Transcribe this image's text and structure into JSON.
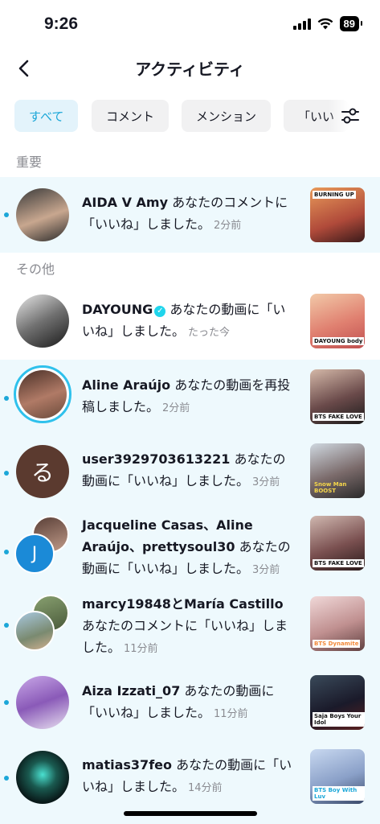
{
  "status": {
    "time": "9:26",
    "battery": "89"
  },
  "header": {
    "title": "アクティビティ"
  },
  "filters": [
    {
      "label": "すべて",
      "active": true
    },
    {
      "label": "コメント",
      "active": false
    },
    {
      "label": "メンション",
      "active": false
    },
    {
      "label": "「いい",
      "active": false
    }
  ],
  "sections": {
    "important": "重要",
    "other": "その他"
  },
  "notifications": [
    {
      "user": "AIDA V Amy",
      "message": "あなたのコメントに「いいね」しました。",
      "time": "2分前",
      "unread": true,
      "thumb_text": "BURNING UP"
    },
    {
      "user": "DAYOUNG",
      "verified": true,
      "message": "あなたの動画に「いいね」しました。",
      "time": "たった今",
      "unread": false,
      "thumb_text": "DAYOUNG body"
    },
    {
      "user": "Aline Araújo",
      "message": "あなたの動画を再投稿しました。",
      "time": "2分前",
      "unread": true,
      "thumb_text": "BTS FAKE LOVE"
    },
    {
      "user": "user3929703613221",
      "avatar_letter": "る",
      "message": "あなたの動画に「いいね」しました。",
      "time": "3分前",
      "unread": true,
      "thumb_text": "Snow Man BOOST"
    },
    {
      "user": "Jacqueline Casas、Aline Araújo、prettysoul30",
      "avatar_letter": "J",
      "message": "あなたの動画に「いいね」しました。",
      "time": "3分前",
      "unread": true,
      "thumb_text": "BTS FAKE LOVE"
    },
    {
      "user": "marcy19848とMaría Castillo",
      "message": "あなたのコメントに「いいね」しました。",
      "time": "11分前",
      "unread": true,
      "thumb_text": "BTS Dynamite"
    },
    {
      "user": "Aiza Izzati_07",
      "message": "あなたの動画に「いいね」しました。",
      "time": "11分前",
      "unread": true,
      "thumb_text": "Saja Boys Your Idol"
    },
    {
      "user": "matias37feo",
      "message": "あなたの動画に「いいね」しました。",
      "time": "14分前",
      "unread": true,
      "thumb_text": "BTS Boy With Luv"
    }
  ]
}
